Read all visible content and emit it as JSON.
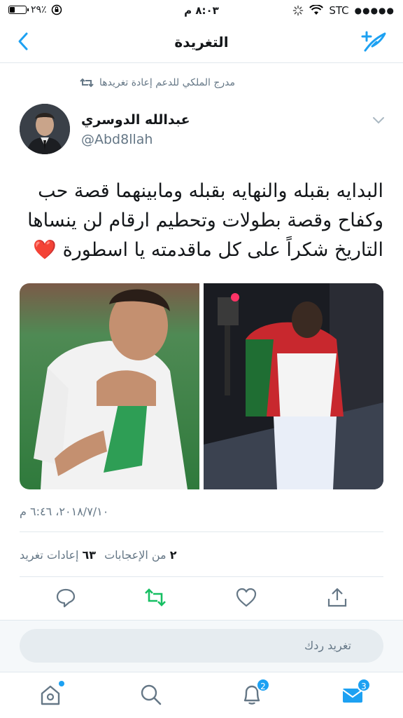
{
  "status_bar": {
    "carrier": "STC",
    "time": "٨:٠٣ م",
    "battery": "٢٩٪",
    "battery_level": 0.29
  },
  "nav": {
    "title": "التغريدة"
  },
  "retweet_context": {
    "text": "مدرج الملكي للدعم إعادة تغريدها"
  },
  "author": {
    "name": "عبدالله الدوسري",
    "handle": "@Abd8llah"
  },
  "tweet": {
    "lines": [
      "البدايه بقبله والنهايه بقبله ومابينهما قصة حب",
      "وكفاح وقصة بطولات وتحطيم ارقام لن ينساها",
      "التاريخ شكراً على كل ماقدمته يا اسطورة"
    ],
    "emoji": "❤️",
    "timestamp": "٢٠١٨/٧/١٠، ٦:٤٦ م"
  },
  "stats": {
    "retweets_count": "٦٣",
    "retweets_label": "إعادات تغريد",
    "likes_count": "٢",
    "likes_label": "من الإعجابات"
  },
  "reply": {
    "placeholder": "تغريد ردك"
  },
  "tabs": {
    "notifications_badge": "2",
    "messages_badge": "3"
  },
  "colors": {
    "accent": "#1da1f2",
    "retweet_green": "#17bf63",
    "muted": "#657786",
    "like_red": "#e0245e"
  }
}
